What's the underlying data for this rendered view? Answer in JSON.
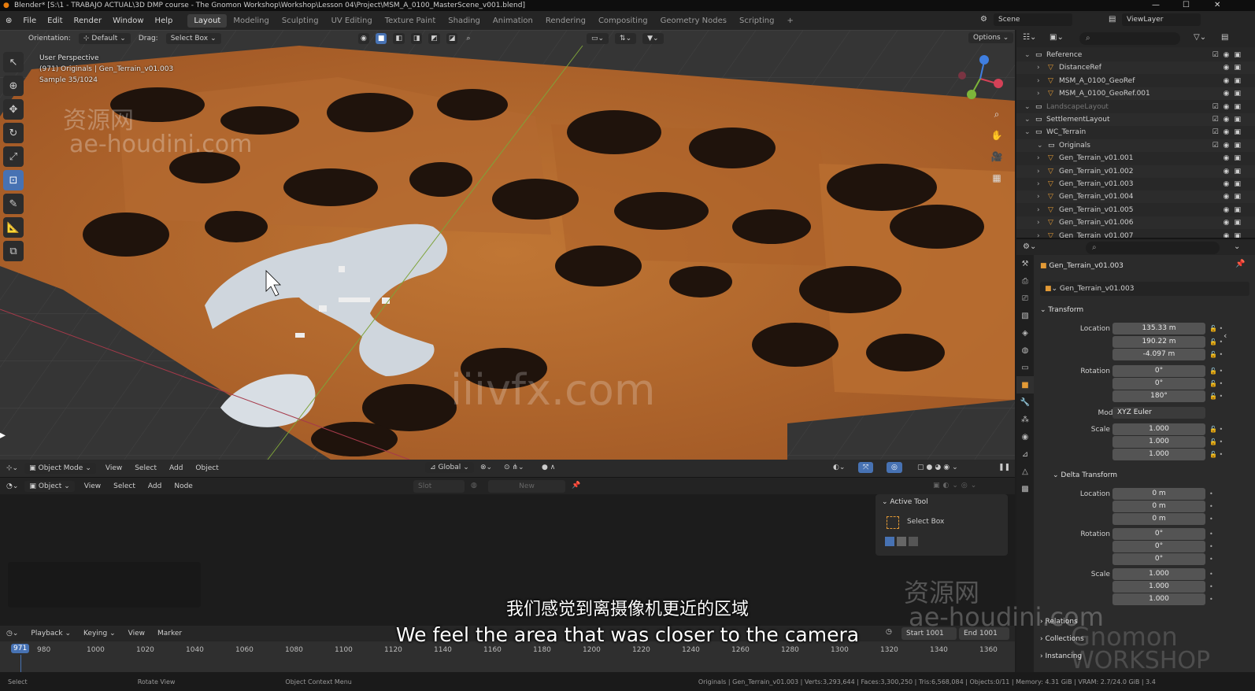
{
  "window": {
    "title": "Blender* [S:\\1 - TRABAJO ACTUAL\\3D DMP course - The Gnomon Workshop\\Workshop\\Lesson 04\\Project\\MSM_A_0100_MasterScene_v001.blend]"
  },
  "menu": {
    "items": [
      "File",
      "Edit",
      "Render",
      "Window",
      "Help"
    ],
    "workspaces": [
      "Layout",
      "Modeling",
      "Sculpting",
      "UV Editing",
      "Texture Paint",
      "Shading",
      "Animation",
      "Rendering",
      "Compositing",
      "Geometry Nodes",
      "Scripting"
    ],
    "active_workspace": "Layout",
    "add_tab": "+",
    "scene": "Scene",
    "view_layer": "ViewLayer"
  },
  "viewport": {
    "orientation_label": "Orientation:",
    "orientation_value": "Default",
    "drag_label": "Drag:",
    "drag_value": "Select Box",
    "options_label": "Options",
    "overlay_line1": "User Perspective",
    "overlay_line2": "(971) Originals | Gen_Terrain_v01.003",
    "overlay_line3": "Sample 35/1024",
    "mode": "Object Mode",
    "menus": [
      "View",
      "Select",
      "Add",
      "Object"
    ],
    "transform_space": "Global",
    "colors": {
      "terrain": "#b86a2e",
      "terrain_dark": "#1c120c",
      "snow": "#d6dce2",
      "grid": "#3e3e3e",
      "accent": "#4772b3"
    }
  },
  "shader_editor": {
    "type": "Object",
    "menus": [
      "View",
      "Select",
      "Add",
      "Node"
    ],
    "slot_label": "Slot",
    "new_label": "New"
  },
  "active_tool": {
    "heading": "Active Tool",
    "tool": "Select Box"
  },
  "timeline": {
    "menus": [
      "Playback",
      "Keying",
      "View",
      "Marker"
    ],
    "current_frame": "971",
    "start_label": "Start",
    "start": "1001",
    "end_label": "End",
    "end": "1001",
    "frames": [
      "980",
      "1000",
      "1020",
      "1040",
      "1060",
      "1080",
      "1100",
      "1120",
      "1140",
      "1160",
      "1180",
      "1200",
      "1220",
      "1240",
      "1260",
      "1280",
      "1300",
      "1320",
      "1340",
      "1360"
    ]
  },
  "status": {
    "select": "Select",
    "rotate": "Rotate View",
    "context": "Object Context Menu",
    "stats": "Originals | Gen_Terrain_v01.003 | Verts:3,293,644 | Faces:3,300,250 | Tris:6,568,084 | Objects:0/11 | Memory: 4.31 GiB | VRAM: 2.7/24.0 GiB | 3.4"
  },
  "outliner": {
    "rows": [
      {
        "name": "Reference",
        "indent": 1,
        "icon": "collection",
        "dim": false
      },
      {
        "name": "DistanceRef",
        "indent": 2,
        "icon": "object",
        "dim": false
      },
      {
        "name": "MSM_A_0100_GeoRef",
        "indent": 2,
        "icon": "mesh",
        "dim": false
      },
      {
        "name": "MSM_A_0100_GeoRef.001",
        "indent": 2,
        "icon": "mesh",
        "dim": false
      },
      {
        "name": "LandscapeLayout",
        "indent": 1,
        "icon": "collection",
        "dim": true
      },
      {
        "name": "SettlementLayout",
        "indent": 1,
        "icon": "collection",
        "dim": false
      },
      {
        "name": "WC_Terrain",
        "indent": 1,
        "icon": "collection",
        "dim": false
      },
      {
        "name": "Originals",
        "indent": 2,
        "icon": "collection",
        "dim": false
      },
      {
        "name": "Gen_Terrain_v01.001",
        "indent": 2,
        "icon": "mesh",
        "dim": false
      },
      {
        "name": "Gen_Terrain_v01.002",
        "indent": 2,
        "icon": "mesh",
        "dim": false
      },
      {
        "name": "Gen_Terrain_v01.003",
        "indent": 2,
        "icon": "mesh",
        "dim": false
      },
      {
        "name": "Gen_Terrain_v01.004",
        "indent": 2,
        "icon": "mesh",
        "dim": false
      },
      {
        "name": "Gen_Terrain_v01.005",
        "indent": 2,
        "icon": "mesh",
        "dim": false
      },
      {
        "name": "Gen_Terrain_v01.006",
        "indent": 2,
        "icon": "mesh",
        "dim": false
      },
      {
        "name": "Gen_Terrain_v01.007",
        "indent": 2,
        "icon": "mesh",
        "dim": false
      }
    ]
  },
  "properties": {
    "object_name": "Gen_Terrain_v01.003",
    "object_name_field": "Gen_Terrain_v01.003",
    "transform_heading": "Transform",
    "location_x_label": "Location X",
    "location_x": "135.33 m",
    "location_y_label": "Y",
    "location_y": "190.22 m",
    "location_z_label": "Z",
    "location_z": "-4.097 m",
    "rotation_x_label": "Rotation X",
    "rotation_x": "0°",
    "rotation_y_label": "Y",
    "rotation_y": "0°",
    "rotation_z_label": "Z",
    "rotation_z": "180°",
    "mode_label": "Mode",
    "mode": "XYZ Euler",
    "scale_x_label": "Scale X",
    "scale_x": "1.000",
    "scale_y_label": "Y",
    "scale_y": "1.000",
    "scale_z_label": "Z",
    "scale_z": "1.000",
    "delta_heading": "Delta Transform",
    "d_location_x_label": "Location X",
    "d_location_x": "0 m",
    "d_location_y_label": "Y",
    "d_location_y": "0 m",
    "d_location_z_label": "Z",
    "d_location_z": "0 m",
    "d_rotation_x_label": "Rotation X",
    "d_rotation_x": "0°",
    "d_rotation_y_label": "Y",
    "d_rotation_y": "0°",
    "d_rotation_z_label": "Z",
    "d_rotation_z": "0°",
    "d_scale_x_label": "Scale X",
    "d_scale_x": "1.000",
    "d_scale_y_label": "Y",
    "d_scale_y": "1.000",
    "d_scale_z_label": "Z",
    "d_scale_z": "1.000",
    "relations_heading": "Relations",
    "collections_heading": "Collections",
    "instancing_heading": "Instancing"
  },
  "overlays": {
    "watermark_cn": "资源网",
    "watermark_en": "ae-houdini.com",
    "watermark_center": "iiivfx.com",
    "watermark_cn2": "资源网",
    "watermark_en2": "ae-houdini.com",
    "gnomon_1": "Gnomon",
    "gnomon_2": "WORKSHOP",
    "subtitle_cn": "我们感觉到离摄像机更近的区域",
    "subtitle_en": "We feel the area that was closer to the camera"
  }
}
